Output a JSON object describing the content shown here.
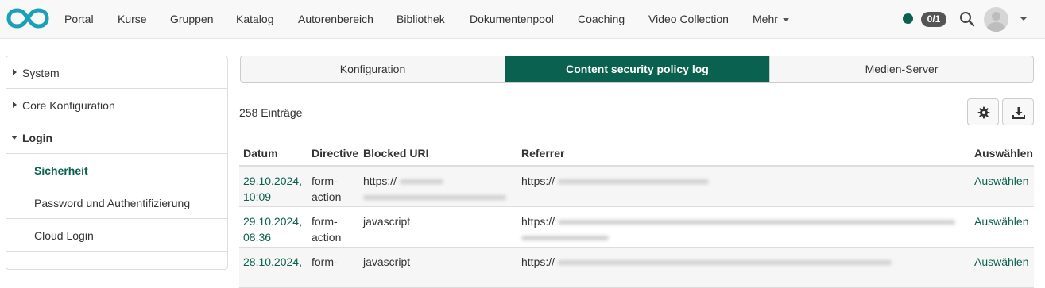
{
  "nav": {
    "items": [
      "Portal",
      "Kurse",
      "Gruppen",
      "Katalog",
      "Autorenbereich",
      "Bibliothek",
      "Dokumentenpool",
      "Coaching",
      "Video Collection"
    ],
    "more_label": "Mehr",
    "counter": "0/1",
    "brand_color": "#0b6150"
  },
  "sidebar": {
    "items": [
      {
        "label": "System",
        "state": "collapsed"
      },
      {
        "label": "Core Konfiguration",
        "state": "collapsed"
      },
      {
        "label": "Login",
        "state": "expanded"
      },
      {
        "label": "Sicherheit",
        "state": "active-child"
      },
      {
        "label": "Password und Authentifizierung",
        "state": "child"
      },
      {
        "label": "Cloud Login",
        "state": "child"
      }
    ]
  },
  "tabs": [
    {
      "label": "Konfiguration",
      "active": false
    },
    {
      "label": "Content security policy log",
      "active": true
    },
    {
      "label": "Medien-Server",
      "active": false
    }
  ],
  "entries_label": "258 Einträge",
  "toolbar": {
    "settings_icon": "gear-icon",
    "download_icon": "download-icon"
  },
  "table": {
    "headers": {
      "date": "Datum",
      "directive": "Directive",
      "blocked": "Blocked URI",
      "referrer": "Referrer",
      "select": "Auswählen"
    },
    "rows": [
      {
        "date_1": "29.10.2024,",
        "date_2": "10:09",
        "directive_1": "form-",
        "directive_2": "action",
        "blocked": "https://",
        "referrer": "https://",
        "select": "Auswählen"
      },
      {
        "date_1": "29.10.2024,",
        "date_2": "08:36",
        "directive_1": "form-",
        "directive_2": "action",
        "blocked": "javascript",
        "referrer": "https://",
        "select": "Auswählen"
      },
      {
        "date_1": "28.10.2024,",
        "date_2": "",
        "directive_1": "form-",
        "directive_2": "",
        "blocked": "javascript",
        "referrer": "https://",
        "select": "Auswählen"
      }
    ]
  }
}
